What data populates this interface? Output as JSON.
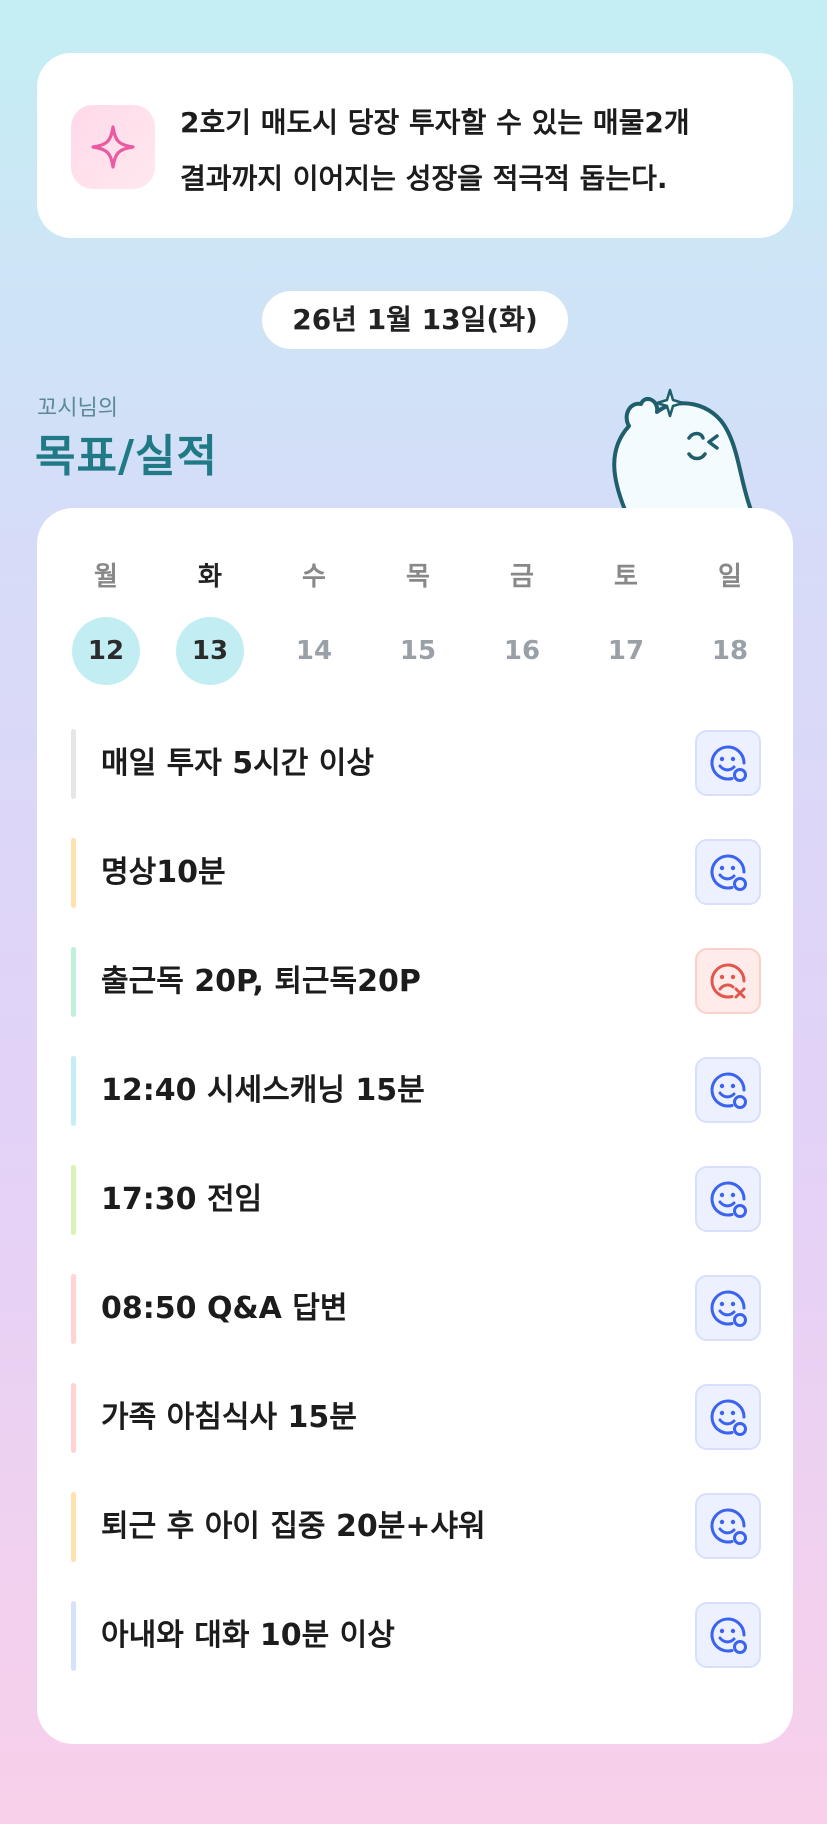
{
  "motto": {
    "icon": "sparkle-icon",
    "line1": "2호기 매도시 당장 투자할 수 있는 매물2개",
    "line2": "결과까지 이어지는 성장을 적극적 돕는다."
  },
  "date": "26년 1월 13일(화)",
  "owner": "꼬시님의",
  "title": "목표/실적",
  "mascot_icon": "ghost-mascot-icon",
  "week": [
    {
      "day": "월",
      "date": "12",
      "done": true,
      "today": false
    },
    {
      "day": "화",
      "date": "13",
      "done": true,
      "today": true
    },
    {
      "day": "수",
      "date": "14",
      "done": false,
      "today": false
    },
    {
      "day": "목",
      "date": "15",
      "done": false,
      "today": false
    },
    {
      "day": "금",
      "date": "16",
      "done": false,
      "today": false
    },
    {
      "day": "토",
      "date": "17",
      "done": false,
      "today": false
    },
    {
      "day": "일",
      "date": "18",
      "done": false,
      "today": false
    }
  ],
  "goals": [
    {
      "label": "매일 투자 5시간 이상",
      "color": "#e6e6e6",
      "status": "achieved"
    },
    {
      "label": "명상10분",
      "color": "#ffe1ae",
      "status": "achieved"
    },
    {
      "label": "출근독 20P, 퇴근독20P",
      "color": "#bff0d8",
      "status": "failed"
    },
    {
      "label": "12:40 시세스캐닝 15분",
      "color": "#c5eef3",
      "status": "achieved"
    },
    {
      "label": "17:30 전임",
      "color": "#d9f2b5",
      "status": "achieved"
    },
    {
      "label": "08:50 Q&A 답변",
      "color": "#ffd3d3",
      "status": "achieved"
    },
    {
      "label": "가족 아침식사 15분",
      "color": "#ffd3d3",
      "status": "achieved"
    },
    {
      "label": "퇴근 후 아이 집중 20분+샤워",
      "color": "#ffe1ae",
      "status": "achieved"
    },
    {
      "label": "아내와 대화 10분 이상",
      "color": "#d6e2fb",
      "status": "achieved"
    }
  ],
  "colors": {
    "achieved_icon": "#3a63ef",
    "failed_icon": "#e2574c",
    "title": "#1f7a86",
    "done_circle": "#c2eef3"
  }
}
